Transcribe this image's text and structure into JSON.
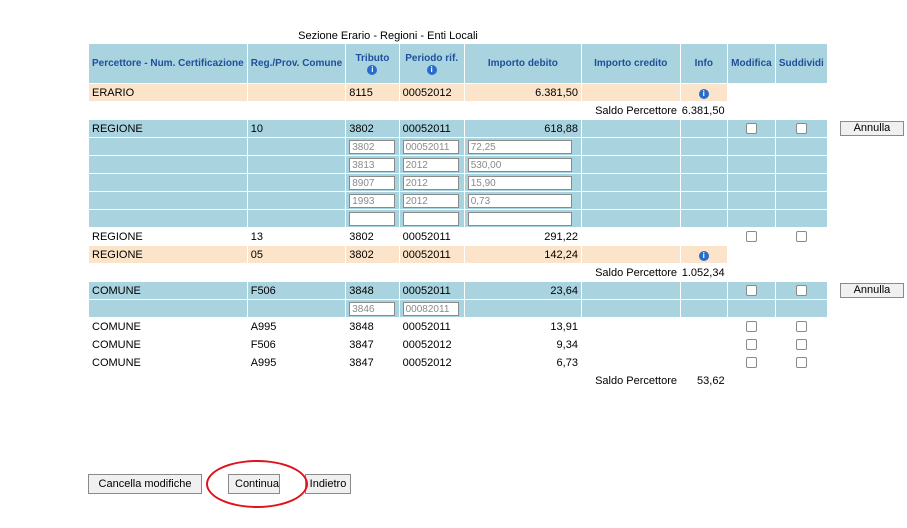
{
  "title": "Sezione Erario - Regioni - Enti Locali",
  "headers": {
    "percettore": "Percettore - Num. Certificazione",
    "reg_prov": "Reg./Prov. Comune",
    "tributo": "Tributo",
    "periodo": "Periodo rif.",
    "importo_debito": "Importo debito",
    "importo_credito": "Importo credito",
    "info": "Info",
    "modifica": "Modifica",
    "suddividi": "Suddividi"
  },
  "info_icon": "info-icon",
  "sections": {
    "erario": {
      "row": {
        "percettore": "ERARIO",
        "reg": "",
        "tributo": "8115",
        "periodo": "00052012",
        "debito": "6.381,50",
        "credito": ""
      },
      "saldo_label": "Saldo Percettore",
      "saldo_value": "6.381,50"
    },
    "regione": {
      "main": {
        "percettore": "REGIONE",
        "reg": "10",
        "tributo": "3802",
        "periodo": "00052011",
        "debito": "618,88",
        "credito": ""
      },
      "split_rows": [
        {
          "tributo": "3802",
          "periodo": "00052011",
          "importo": "72,25"
        },
        {
          "tributo": "3813",
          "periodo": "2012",
          "importo": "530,00"
        },
        {
          "tributo": "8907",
          "periodo": "2012",
          "importo": "15,90"
        },
        {
          "tributo": "1993",
          "periodo": "2012",
          "importo": "0,73"
        },
        {
          "tributo": "",
          "periodo": "",
          "importo": ""
        }
      ],
      "rows": [
        {
          "percettore": "REGIONE",
          "reg": "13",
          "tributo": "3802",
          "periodo": "00052011",
          "debito": "291,22"
        },
        {
          "percettore": "REGIONE",
          "reg": "05",
          "tributo": "3802",
          "periodo": "00052011",
          "debito": "142,24"
        }
      ],
      "saldo_label": "Saldo Percettore",
      "saldo_value": "1.052,34"
    },
    "comune": {
      "main": {
        "percettore": "COMUNE",
        "reg": "F506",
        "tributo": "3848",
        "periodo": "00052011",
        "debito": "23,64"
      },
      "split_row": {
        "tributo": "3846",
        "periodo": "00082011"
      },
      "rows": [
        {
          "percettore": "COMUNE",
          "reg": "A995",
          "tributo": "3848",
          "periodo": "00052011",
          "debito": "13,91"
        },
        {
          "percettore": "COMUNE",
          "reg": "F506",
          "tributo": "3847",
          "periodo": "00052012",
          "debito": "9,34"
        },
        {
          "percettore": "COMUNE",
          "reg": "A995",
          "tributo": "3847",
          "periodo": "00052012",
          "debito": "6,73"
        }
      ],
      "saldo_label": "Saldo Percettore",
      "saldo_value": "53,62"
    }
  },
  "annulla_label": "Annulla",
  "buttons": {
    "cancella": "Cancella modifiche",
    "continua": "Continua",
    "indietro": "Indietro"
  },
  "highlight_color": "#e0121b"
}
